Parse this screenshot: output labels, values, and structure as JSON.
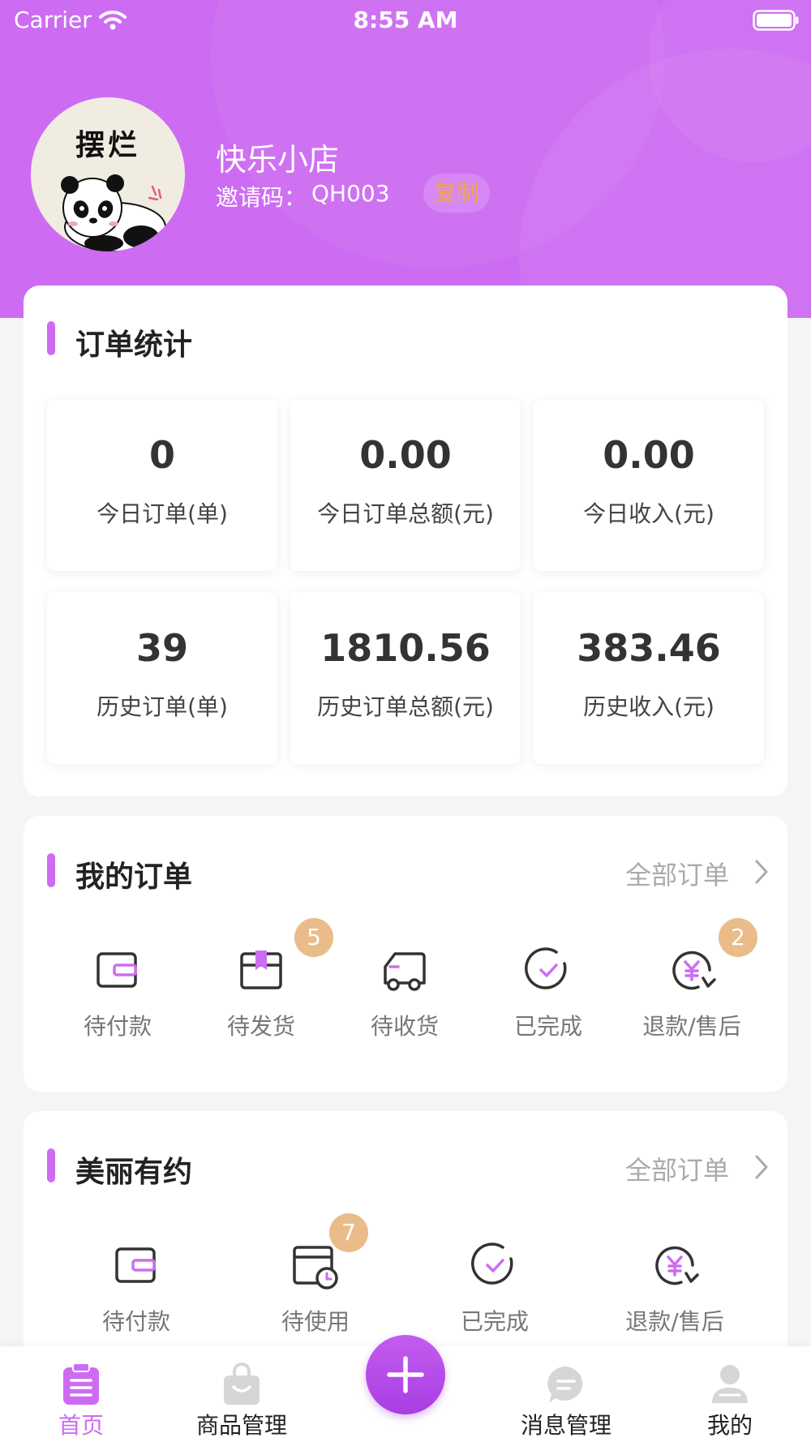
{
  "status_bar": {
    "carrier": "Carrier",
    "time": "8:55 AM"
  },
  "profile": {
    "avatar_caption": "摆烂",
    "shop_name": "快乐小店",
    "invite_label": "邀请码：",
    "invite_code": "QH003",
    "copy_label": "复制"
  },
  "order_stats": {
    "title": "订单统计",
    "items": [
      {
        "value": "0",
        "label": "今日订单(单)"
      },
      {
        "value": "0.00",
        "label": "今日订单总额(元)"
      },
      {
        "value": "0.00",
        "label": "今日收入(元)"
      },
      {
        "value": "39",
        "label": "历史订单(单)"
      },
      {
        "value": "1810.56",
        "label": "历史订单总额(元)"
      },
      {
        "value": "383.46",
        "label": "历史收入(元)"
      }
    ]
  },
  "my_orders": {
    "title": "我的订单",
    "all_link": "全部订单",
    "items": [
      {
        "label": "待付款",
        "icon": "wallet-icon"
      },
      {
        "label": "待发货",
        "icon": "package-icon",
        "badge": "5"
      },
      {
        "label": "待收货",
        "icon": "truck-icon"
      },
      {
        "label": "已完成",
        "icon": "check-circle-icon"
      },
      {
        "label": "退款/售后",
        "icon": "refund-icon",
        "badge": "2"
      }
    ]
  },
  "beauty": {
    "title": "美丽有约",
    "all_link": "全部订单",
    "items": [
      {
        "label": "待付款",
        "icon": "wallet-icon"
      },
      {
        "label": "待使用",
        "icon": "calendar-clock-icon",
        "badge": "7"
      },
      {
        "label": "已完成",
        "icon": "check-circle-icon"
      },
      {
        "label": "退款/售后",
        "icon": "refund-icon"
      }
    ]
  },
  "tabbar": {
    "items": [
      {
        "label": "首页",
        "icon": "clipboard-icon",
        "active": true
      },
      {
        "label": "商品管理",
        "icon": "shopping-bag-icon"
      },
      {
        "label": "消息管理",
        "icon": "chat-icon"
      },
      {
        "label": "我的",
        "icon": "user-icon"
      }
    ],
    "center_icon": "plus-icon"
  },
  "colors": {
    "accent": "#cd6cf2",
    "badge": "#e9bc8a",
    "copy_text": "#f1a64a",
    "background": "#f5f5f7"
  }
}
